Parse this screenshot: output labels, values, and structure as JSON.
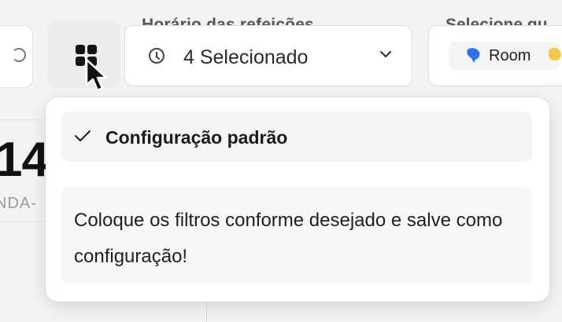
{
  "filters": {
    "meal_time": {
      "label": "Horário das refeições",
      "value": "4 Selecionado"
    },
    "room": {
      "label": "Selecione qu",
      "chip_label": "Room"
    }
  },
  "background_card": {
    "number": "14",
    "caption": "NDA-"
  },
  "preset_dropdown": {
    "option_label": "Configuração padrão",
    "hint": "Coloque os filtros conforme desejado e salve como configuração!"
  },
  "icons": {
    "preset": "preset-grid-icon",
    "clock": "clock-icon",
    "chevron": "chevron-down-icon",
    "check": "check-icon",
    "cursor": "mouse-cursor-icon",
    "room_logo": "room-logo-icon"
  },
  "colors": {
    "background": "#f3f3f3",
    "panel": "#ffffff",
    "option_bg": "#f4f4f4",
    "room_logo": "#2f6fe8"
  }
}
